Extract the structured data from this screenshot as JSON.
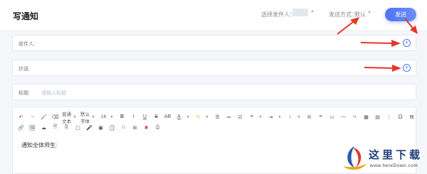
{
  "header": {
    "title": "写通知",
    "sender_label": "选择发件人：",
    "send_method_label": "发送方式：",
    "send_method_value": "默认",
    "send_button": "发送"
  },
  "fields": {
    "recipient_label": "收件人:",
    "cc_label": "抄送:",
    "subject_label": "标题:",
    "subject_placeholder": "请输入标题"
  },
  "toolbar": {
    "paragraph_format": "普通文本",
    "font_family": "默认字体",
    "font_size": "16",
    "bold": "B",
    "italic": "I",
    "underline": "U",
    "strikethrough": "S",
    "letter_spacing": "AB",
    "font_color": "A",
    "special_chars": "Ω",
    "formula": "π"
  },
  "editor": {
    "content": "通知全体师生:"
  },
  "watermark": {
    "title": "这里下载",
    "url": "www.hereDown.com"
  },
  "colors": {
    "accent": "#4f74f5",
    "arrow": "#e8362a",
    "background": "#f4f6fa"
  }
}
